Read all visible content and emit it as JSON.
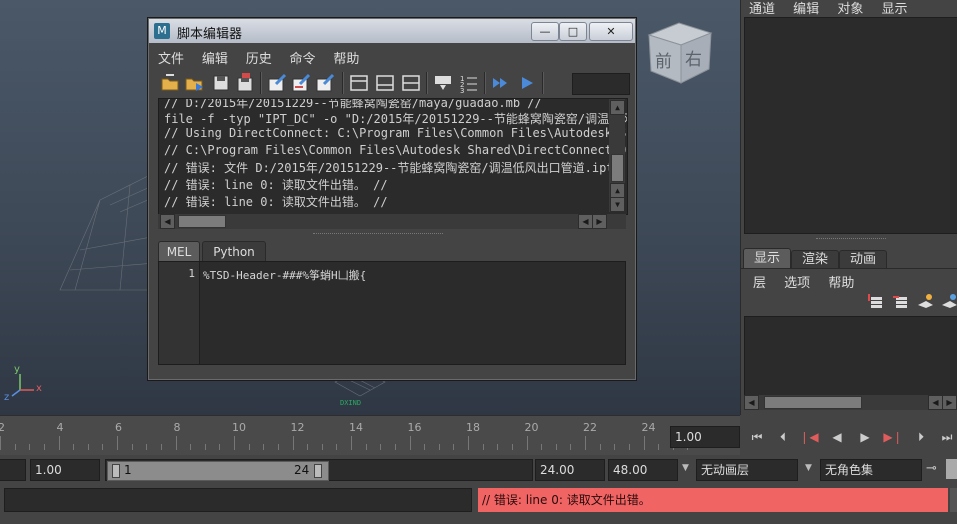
{
  "viewport": {
    "cube_faces": {
      "front": "前",
      "right": "右"
    },
    "axis_labels": {
      "x": "x",
      "y": "y",
      "z": "z"
    }
  },
  "right_panel": {
    "top_menu": [
      "通道",
      "编辑",
      "对象",
      "显示"
    ],
    "layer_tabs": [
      "显示",
      "渲染",
      "动画"
    ],
    "layer_menu": [
      "层",
      "选项",
      "帮助"
    ]
  },
  "script_editor": {
    "title": "脚本编辑器",
    "window_buttons": {
      "minimize": "—",
      "maximize": "□",
      "close": "✕"
    },
    "menu": [
      "文件",
      "编辑",
      "历史",
      "命令",
      "帮助"
    ],
    "history_lines": [
      "// D:/2015年/20151229--节能蜂窝陶瓷窑/maya/guadao.mb //",
      "file -f  -typ \"IPT_DC\" -o \"D:/2015年/20151229--节能蜂窝陶瓷窑/调温低风出口",
      "// Using DirectConnect: C:\\Program Files\\Common Files\\Autodesk S",
      "// C:\\Program Files\\Common Files\\Autodesk Shared\\DirectConnect20",
      "// 错误: 文件 D:/2015年/20151229--节能蜂窝陶瓷窑/调温低风出口管道.ipt",
      "// 错误: line 0: 读取文件出错。 //",
      "// 错误: line 0: 读取文件出错。 //"
    ],
    "tabs": [
      {
        "label": "MEL",
        "active": true
      },
      {
        "label": "Python",
        "active": false
      }
    ],
    "input": {
      "line_number": "1",
      "code": "%TSD-Header-###%筝蛸H凵搬{"
    }
  },
  "timeline": {
    "ticks": [
      "2",
      "4",
      "6",
      "8",
      "10",
      "12",
      "14",
      "16",
      "18",
      "20",
      "22",
      "24"
    ],
    "current_time": "1.00"
  },
  "range": {
    "start_time": "1.00",
    "range_start": "1",
    "range_end": "24",
    "end_time": "24.00",
    "total_end": "48.00",
    "anim_layer": "无动画层",
    "character_set": "无角色集"
  },
  "command_line": {
    "input_value": "",
    "result": "// 错误: line 0: 读取文件出错。"
  },
  "colors": {
    "error_bar": "#f06464",
    "active_tab": "#5c5c5c"
  }
}
